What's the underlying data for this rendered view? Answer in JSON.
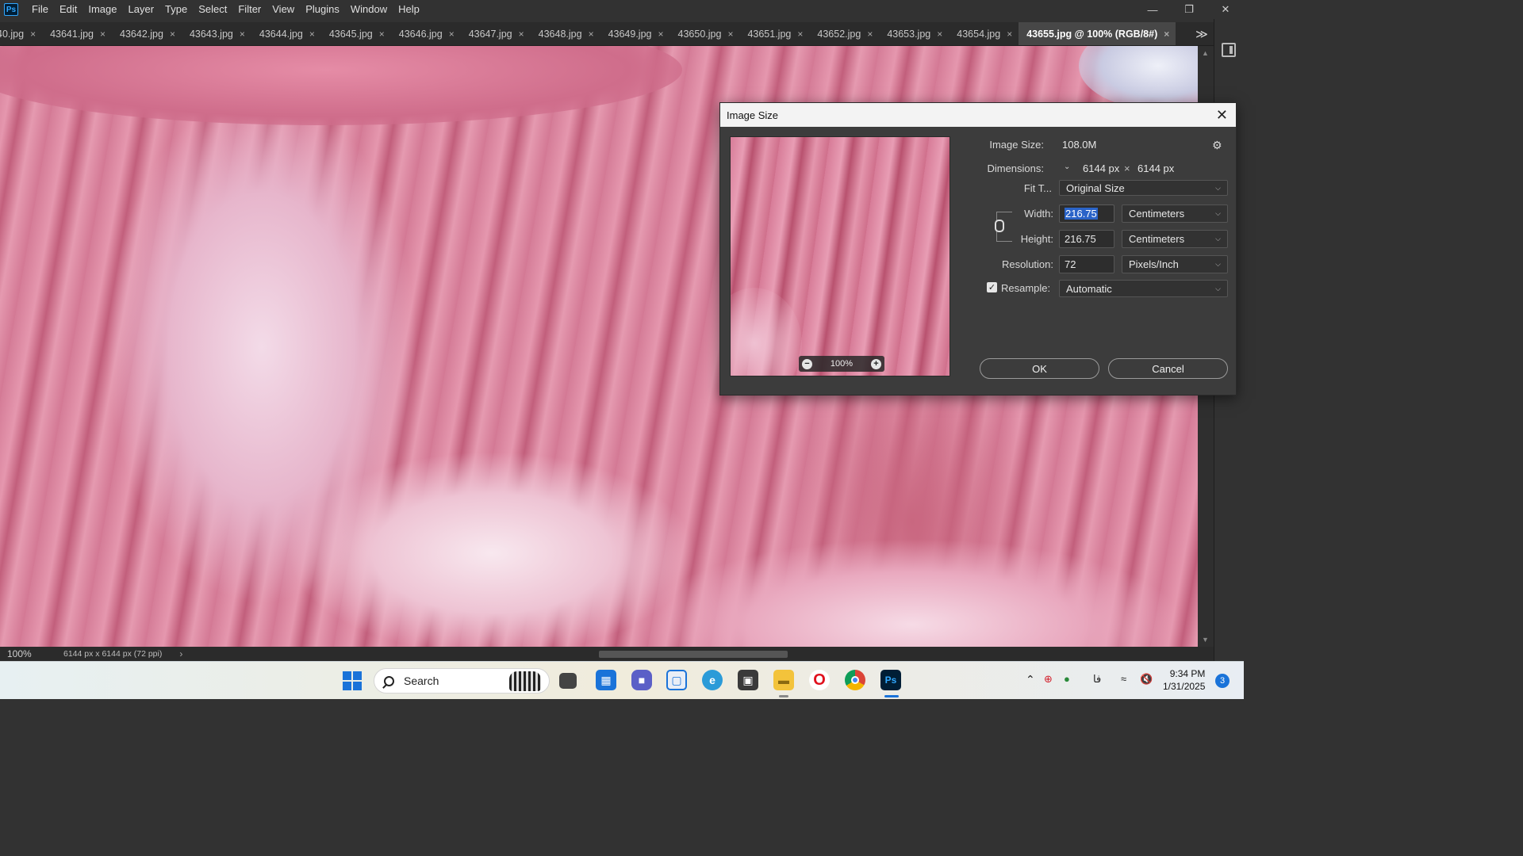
{
  "menu": {
    "app_logo": "Ps",
    "items": [
      "File",
      "Edit",
      "Image",
      "Layer",
      "Type",
      "Select",
      "Filter",
      "View",
      "Plugins",
      "Window",
      "Help"
    ]
  },
  "tabs": [
    {
      "label": "40.jpg",
      "active": false
    },
    {
      "label": "43641.jpg",
      "active": false
    },
    {
      "label": "43642.jpg",
      "active": false
    },
    {
      "label": "43643.jpg",
      "active": false
    },
    {
      "label": "43644.jpg",
      "active": false
    },
    {
      "label": "43645.jpg",
      "active": false
    },
    {
      "label": "43646.jpg",
      "active": false
    },
    {
      "label": "43647.jpg",
      "active": false
    },
    {
      "label": "43648.jpg",
      "active": false
    },
    {
      "label": "43649.jpg",
      "active": false
    },
    {
      "label": "43650.jpg",
      "active": false
    },
    {
      "label": "43651.jpg",
      "active": false
    },
    {
      "label": "43652.jpg",
      "active": false
    },
    {
      "label": "43653.jpg",
      "active": false
    },
    {
      "label": "43654.jpg",
      "active": false
    },
    {
      "label": "43655.jpg @ 100% (RGB/8#)",
      "active": true
    }
  ],
  "tab_close_glyph": "×",
  "tab_more_glyph": "≫",
  "status": {
    "zoom": "100%",
    "doc_info": "6144 px x 6144 px (72 ppi)",
    "arrow": "›"
  },
  "dialog": {
    "title": "Image Size",
    "image_size_label": "Image Size:",
    "image_size_value": "108.0M",
    "dimensions_label": "Dimensions:",
    "dim_width": "6144 px",
    "dim_times": "×",
    "dim_height": "6144 px",
    "fit_to_label": "Fit T...",
    "fit_to_value": "Original Size",
    "width_label": "Width:",
    "width_value": "216.75",
    "width_unit": "Centimeters",
    "height_label": "Height:",
    "height_value": "216.75",
    "height_unit": "Centimeters",
    "resolution_label": "Resolution:",
    "resolution_value": "72",
    "resolution_unit": "Pixels/Inch",
    "resample_label": "Resample:",
    "resample_checked": true,
    "resample_value": "Automatic",
    "preview_zoom": "100%",
    "ok_label": "OK",
    "cancel_label": "Cancel"
  },
  "taskbar": {
    "search_label": "Search",
    "tray_lang": "فا",
    "time": "9:34 PM",
    "date": "1/31/2025",
    "notification_count": "3"
  },
  "colors": {
    "app_bg": "#323232",
    "tab_active": "#474747",
    "dialog_bg": "#3c3c3c",
    "selection": "#2a63c8",
    "windows_blue": "#1a73d9"
  }
}
